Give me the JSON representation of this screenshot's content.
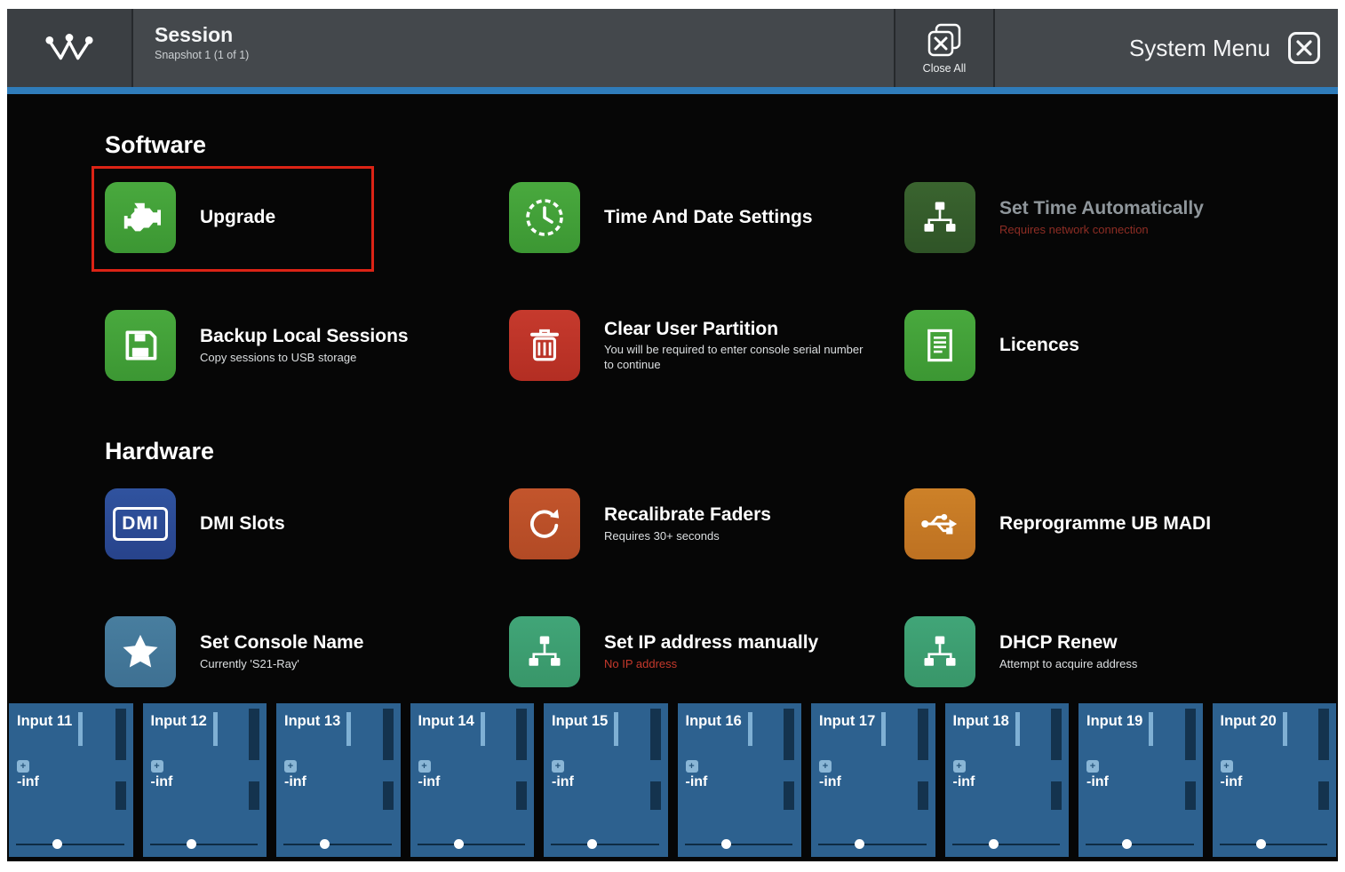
{
  "header": {
    "session_title": "Session",
    "session_subtitle": "Snapshot 1 (1 of 1)",
    "close_all_label": "Close All",
    "menu_title": "System Menu"
  },
  "menu": {
    "sections": [
      {
        "title": "Software",
        "items": [
          {
            "label": "Upgrade",
            "subtitle": "",
            "icon": "engine-icon",
            "highlighted": true
          },
          {
            "label": "Time And Date Settings",
            "subtitle": "",
            "icon": "clock-icon"
          },
          {
            "label": "Set Time Automatically",
            "subtitle": "Requires network connection",
            "icon": "network-icon",
            "disabled": true
          },
          {
            "label": "Backup Local Sessions",
            "subtitle": "Copy sessions to USB storage",
            "icon": "floppy-disk-icon"
          },
          {
            "label": "Clear User Partition",
            "subtitle": "You will be required to enter console serial number to continue",
            "icon": "trash-icon"
          },
          {
            "label": "Licences",
            "subtitle": "",
            "icon": "document-icon"
          }
        ]
      },
      {
        "title": "Hardware",
        "items": [
          {
            "label": "DMI Slots",
            "subtitle": "",
            "icon": "dmi-icon",
            "icon_label": "DMI"
          },
          {
            "label": "Recalibrate Faders",
            "subtitle": "Requires 30+ seconds",
            "icon": "recalibrate-icon"
          },
          {
            "label": "Reprogramme UB MADI",
            "subtitle": "",
            "icon": "usb-icon"
          },
          {
            "label": "Set Console Name",
            "subtitle": "Currently 'S21-Ray'",
            "icon": "star-icon"
          },
          {
            "label": "Set IP address manually",
            "subtitle": "No IP address",
            "icon": "network-icon",
            "subtitle_warning": true
          },
          {
            "label": "DHCP Renew",
            "subtitle": "Attempt to acquire address",
            "icon": "network-icon"
          }
        ]
      }
    ]
  },
  "channels": [
    {
      "name": "Input 11",
      "gain": "-inf"
    },
    {
      "name": "Input 12",
      "gain": "-inf"
    },
    {
      "name": "Input 13",
      "gain": "-inf"
    },
    {
      "name": "Input 14",
      "gain": "-inf"
    },
    {
      "name": "Input 15",
      "gain": "-inf"
    },
    {
      "name": "Input 16",
      "gain": "-inf"
    },
    {
      "name": "Input 17",
      "gain": "-inf"
    },
    {
      "name": "Input 18",
      "gain": "-inf"
    },
    {
      "name": "Input 19",
      "gain": "-inf"
    },
    {
      "name": "Input 20",
      "gain": "-inf"
    }
  ],
  "colors": {
    "accent_blue": "#2f7cba",
    "header_bg": "#44484c",
    "tile_green": "#43a038",
    "tile_dark_green": "#355c2b",
    "tile_red": "#bd3428",
    "tile_blue": "#2b4b96",
    "tile_rust": "#bc5029",
    "tile_orange": "#c67925",
    "tile_steel_blue": "#437797",
    "tile_teal": "#3d9e71",
    "warning_red": "#c5392c",
    "channel_bg": "#2d618f"
  }
}
